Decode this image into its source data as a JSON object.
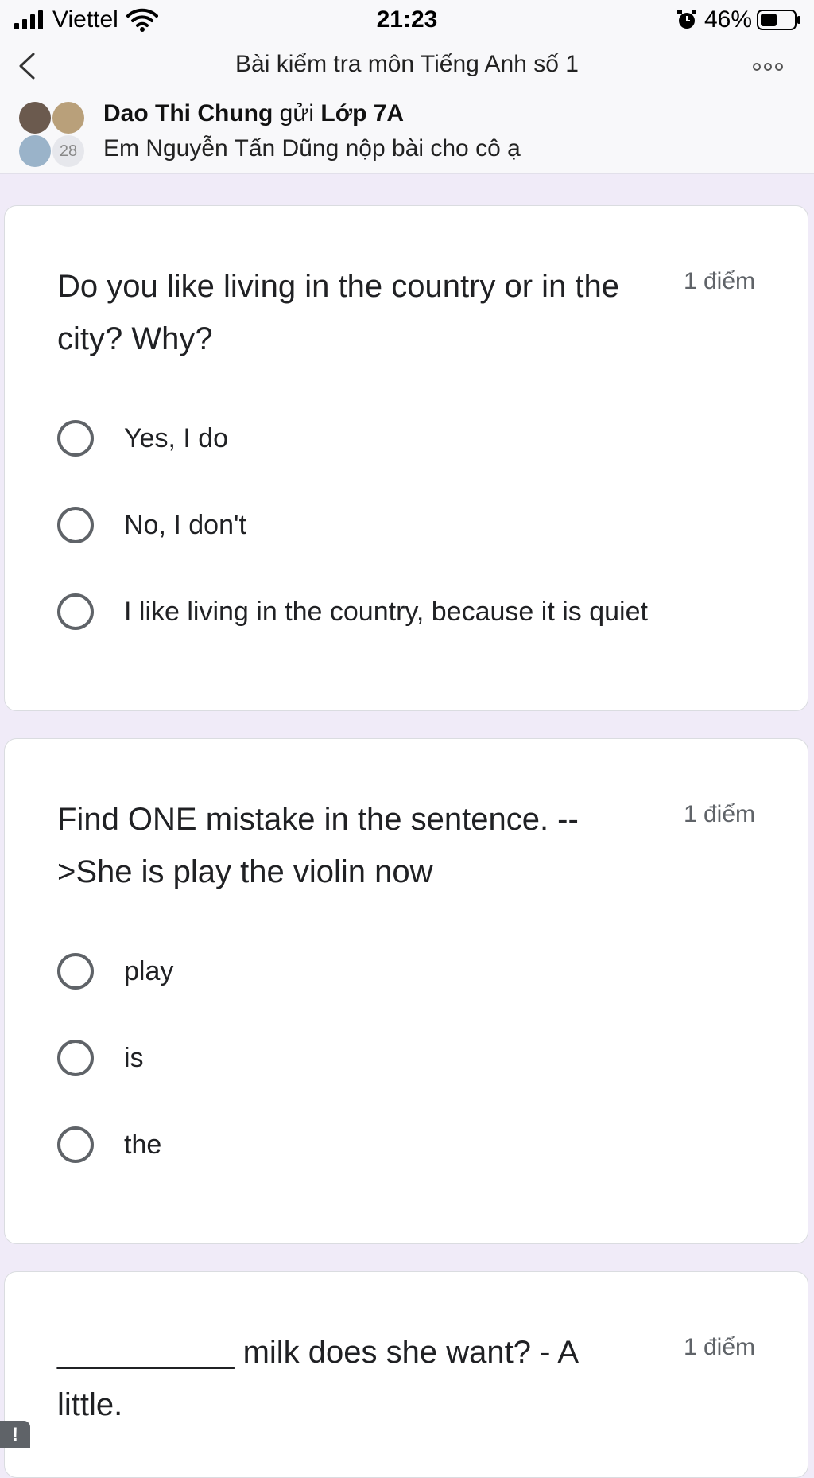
{
  "status_bar": {
    "carrier": "Viettel",
    "time": "21:23",
    "battery_percent": "46%"
  },
  "nav": {
    "title": "Bài kiểm tra môn Tiếng Anh số 1"
  },
  "chat_header": {
    "sender": "Dao Thi Chung",
    "verb": "gửi",
    "group": "Lớp 7A",
    "message": "Em Nguyễn Tấn Dũng nộp bài cho cô ạ",
    "member_count": "28"
  },
  "questions": [
    {
      "title": "Do you like living in the country or in the city? Why?",
      "points": "1 điểm",
      "options": [
        "Yes, I do",
        "No, I don't",
        "I like living in the country, because it is quiet"
      ]
    },
    {
      "title": "Find ONE mistake in the sentence. -->She is play the violin now",
      "points": "1 điểm",
      "options": [
        "play",
        "is",
        "the"
      ]
    },
    {
      "title": "__________ milk does she want? - A little.",
      "points": "1 điểm",
      "options": []
    }
  ],
  "corner_badge": "!",
  "colors": {
    "page_background": "#f0ebf8",
    "card_background": "#ffffff",
    "radio_border": "#5f6368",
    "status_bar_background": "#f8f8fa"
  },
  "icons": [
    "signal-icon",
    "wifi-icon",
    "alarm-icon",
    "battery-icon",
    "back-chevron-icon",
    "more-options-icon"
  ]
}
